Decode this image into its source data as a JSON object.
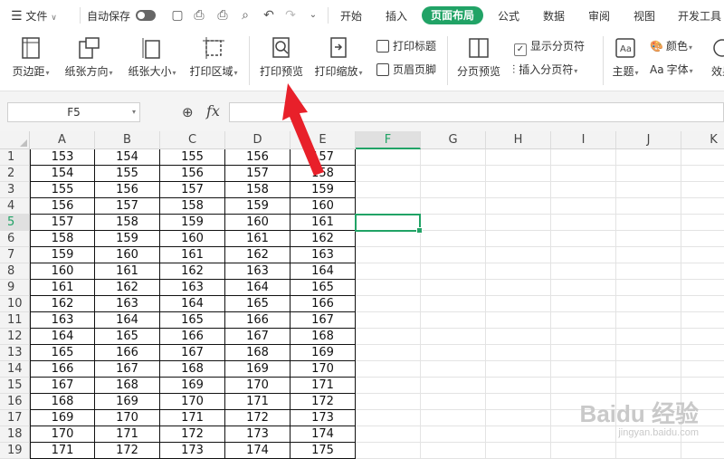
{
  "topbar": {
    "menu_label": "文件",
    "autosave_label": "自动保存",
    "tabs": [
      "开始",
      "插入",
      "页面布局",
      "公式",
      "数据",
      "审阅",
      "视图",
      "开发工具"
    ],
    "active_tab": "页面布局"
  },
  "ribbon": {
    "margins": "页边距",
    "orientation": "纸张方向",
    "paper_size": "纸张大小",
    "print_area": "打印区域",
    "print_preview": "打印预览",
    "print_scale": "打印缩放",
    "print_titles": "打印标题",
    "header_footer": "页眉页脚",
    "page_break_preview": "分页预览",
    "show_page_breaks": "显示分页符",
    "insert_page_break": "插入分页符",
    "theme": "主题",
    "colors": "颜色",
    "fonts": "字体",
    "effects": "效果"
  },
  "formula_bar": {
    "name_box": "F5",
    "fx": "fx",
    "value": ""
  },
  "sheet": {
    "columns": [
      "A",
      "B",
      "C",
      "D",
      "E",
      "F",
      "G",
      "H",
      "I",
      "J",
      "K"
    ],
    "selected_cell": "F5",
    "rows": [
      {
        "r": "1",
        "v": [
          "153",
          "154",
          "155",
          "156",
          "157"
        ]
      },
      {
        "r": "2",
        "v": [
          "154",
          "155",
          "156",
          "157",
          "158"
        ]
      },
      {
        "r": "3",
        "v": [
          "155",
          "156",
          "157",
          "158",
          "159"
        ]
      },
      {
        "r": "4",
        "v": [
          "156",
          "157",
          "158",
          "159",
          "160"
        ]
      },
      {
        "r": "5",
        "v": [
          "157",
          "158",
          "159",
          "160",
          "161"
        ]
      },
      {
        "r": "6",
        "v": [
          "158",
          "159",
          "160",
          "161",
          "162"
        ]
      },
      {
        "r": "7",
        "v": [
          "159",
          "160",
          "161",
          "162",
          "163"
        ]
      },
      {
        "r": "8",
        "v": [
          "160",
          "161",
          "162",
          "163",
          "164"
        ]
      },
      {
        "r": "9",
        "v": [
          "161",
          "162",
          "163",
          "164",
          "165"
        ]
      },
      {
        "r": "10",
        "v": [
          "162",
          "163",
          "164",
          "165",
          "166"
        ]
      },
      {
        "r": "11",
        "v": [
          "163",
          "164",
          "165",
          "166",
          "167"
        ]
      },
      {
        "r": "12",
        "v": [
          "164",
          "165",
          "166",
          "167",
          "168"
        ]
      },
      {
        "r": "13",
        "v": [
          "165",
          "166",
          "167",
          "168",
          "169"
        ]
      },
      {
        "r": "14",
        "v": [
          "166",
          "167",
          "168",
          "169",
          "170"
        ]
      },
      {
        "r": "15",
        "v": [
          "167",
          "168",
          "169",
          "170",
          "171"
        ]
      },
      {
        "r": "16",
        "v": [
          "168",
          "169",
          "170",
          "171",
          "172"
        ]
      },
      {
        "r": "17",
        "v": [
          "169",
          "170",
          "171",
          "172",
          "173"
        ]
      },
      {
        "r": "18",
        "v": [
          "170",
          "171",
          "172",
          "173",
          "174"
        ]
      },
      {
        "r": "19",
        "v": [
          "171",
          "172",
          "173",
          "174",
          "175"
        ]
      }
    ]
  },
  "watermark": {
    "main": "Baidu 经验",
    "sub": "jingyan.baidu.com"
  },
  "colors": {
    "accent": "#21a366",
    "arrow": "#e8202a"
  }
}
